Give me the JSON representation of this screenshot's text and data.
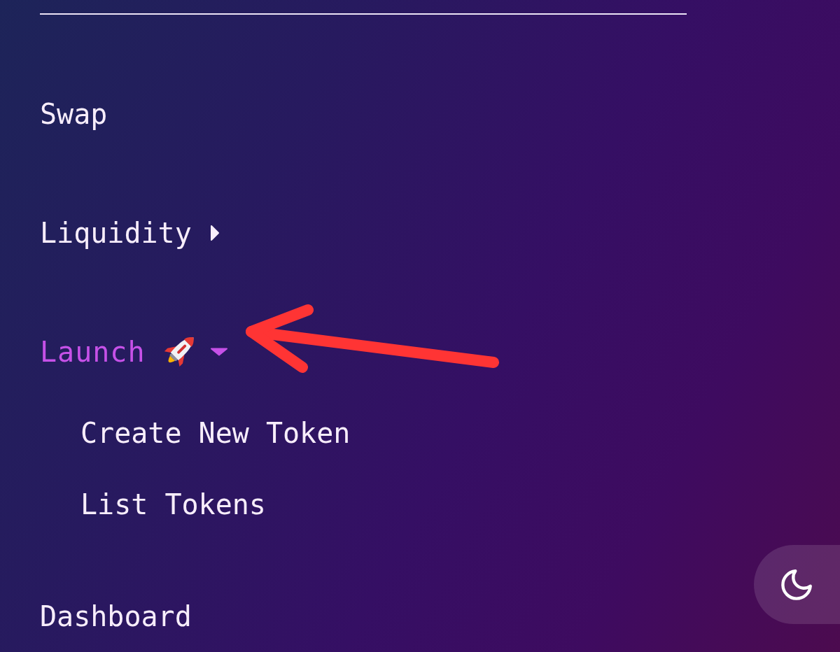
{
  "menu": {
    "items": [
      {
        "kind": "link",
        "label": "Swap",
        "selected": false,
        "icon": false
      },
      {
        "kind": "dropdown",
        "label": "Liquidity",
        "selected": false,
        "expanded": false,
        "icon": false
      },
      {
        "kind": "dropdown",
        "label": "Launch",
        "selected": true,
        "expanded": true,
        "icon": true,
        "children": [
          {
            "label": "Create New Token",
            "selected": false
          },
          {
            "label": "List Tokens",
            "selected": false
          }
        ]
      },
      {
        "kind": "link",
        "label": "Dashboard",
        "selected": false,
        "icon": false
      }
    ]
  },
  "annotation": {
    "kind": "arrow"
  },
  "theme_toggle": {
    "dark_mode": true
  }
}
